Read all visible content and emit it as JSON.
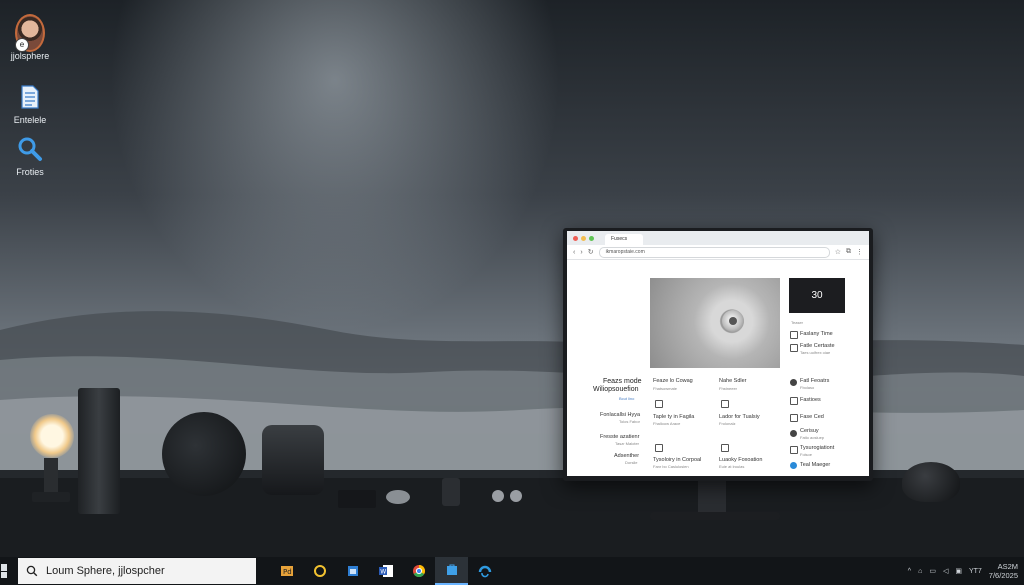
{
  "desktop": {
    "icons": [
      {
        "label": "jjolsphere",
        "icon": "user-avatar-icon"
      },
      {
        "label": "Entelele",
        "icon": "document-icon"
      },
      {
        "label": "Froties",
        "icon": "search-icon"
      }
    ]
  },
  "browser": {
    "tab_title": "Fusecs",
    "url": "ikmaropstaie.com",
    "promo_text": "30",
    "hero_caption": "Teaser",
    "left_heading_line1": "Feazs mode",
    "left_heading_line2": "Wiliopsouefion",
    "left_heading_link": "Bcut lino",
    "left_items": [
      {
        "title": "Fonlacallsi Hyya",
        "sub": "Tolos Fabor"
      },
      {
        "title": "Fresste azatienr",
        "sub": "Taszr Maloter"
      },
      {
        "title": "Adsenther",
        "sub": "Dorslle"
      }
    ],
    "col1_heading": "Feaze lo Cowag",
    "col1_heading_sub": "Fhatsowmate",
    "col2_heading": "Nahe Sdler",
    "col2_heading_sub": "Fhstneeer",
    "col1_items": [
      {
        "title": "Taple ty in Fagila",
        "sub": "Fhalloow Arace"
      },
      {
        "title": "Tysoloiry in Corpoal",
        "sub": "Fanr bo Caslulosien"
      }
    ],
    "col2_items": [
      {
        "title": "Lador for Tualsiy",
        "sub": "Frolonalz"
      },
      {
        "title": "Luaoky Foxoation",
        "sub": "Euie at lroulas"
      }
    ],
    "right_items": [
      {
        "title": "Faslany Time",
        "sub": ""
      },
      {
        "title": "Fatle Certaste",
        "sub": "Taes uolfrex oiae"
      },
      {
        "title": "Fatl Feoatrs",
        "sub": "Fbolaso"
      },
      {
        "title": "Fastioes",
        "sub": ""
      },
      {
        "title": "Fase Ced",
        "sub": ""
      },
      {
        "title": "Cerisuy",
        "sub": "Fatlo aosluep"
      },
      {
        "title": "Tysurogiationt",
        "sub": "Folsoe"
      },
      {
        "title": "Teal Maeger",
        "sub": ""
      }
    ]
  },
  "taskbar": {
    "search_text": "Loum Sphere, jjlospcher",
    "apps": [
      {
        "name": "photos-app-icon",
        "active": false
      },
      {
        "name": "cortana-app-icon",
        "active": false
      },
      {
        "name": "calendar-app-icon",
        "active": false
      },
      {
        "name": "word-app-icon",
        "active": false
      },
      {
        "name": "chrome-app-icon",
        "active": false
      },
      {
        "name": "store-app-icon",
        "active": true
      },
      {
        "name": "edge-app-icon",
        "active": false
      }
    ],
    "tray": {
      "time": "AS2M",
      "date": "7/6/2025",
      "badge": "ΥΤ7"
    }
  },
  "colors": {
    "accent": "#2a8ad8",
    "taskbar_bg": "#121518",
    "search_bg": "#f3f3f3"
  }
}
